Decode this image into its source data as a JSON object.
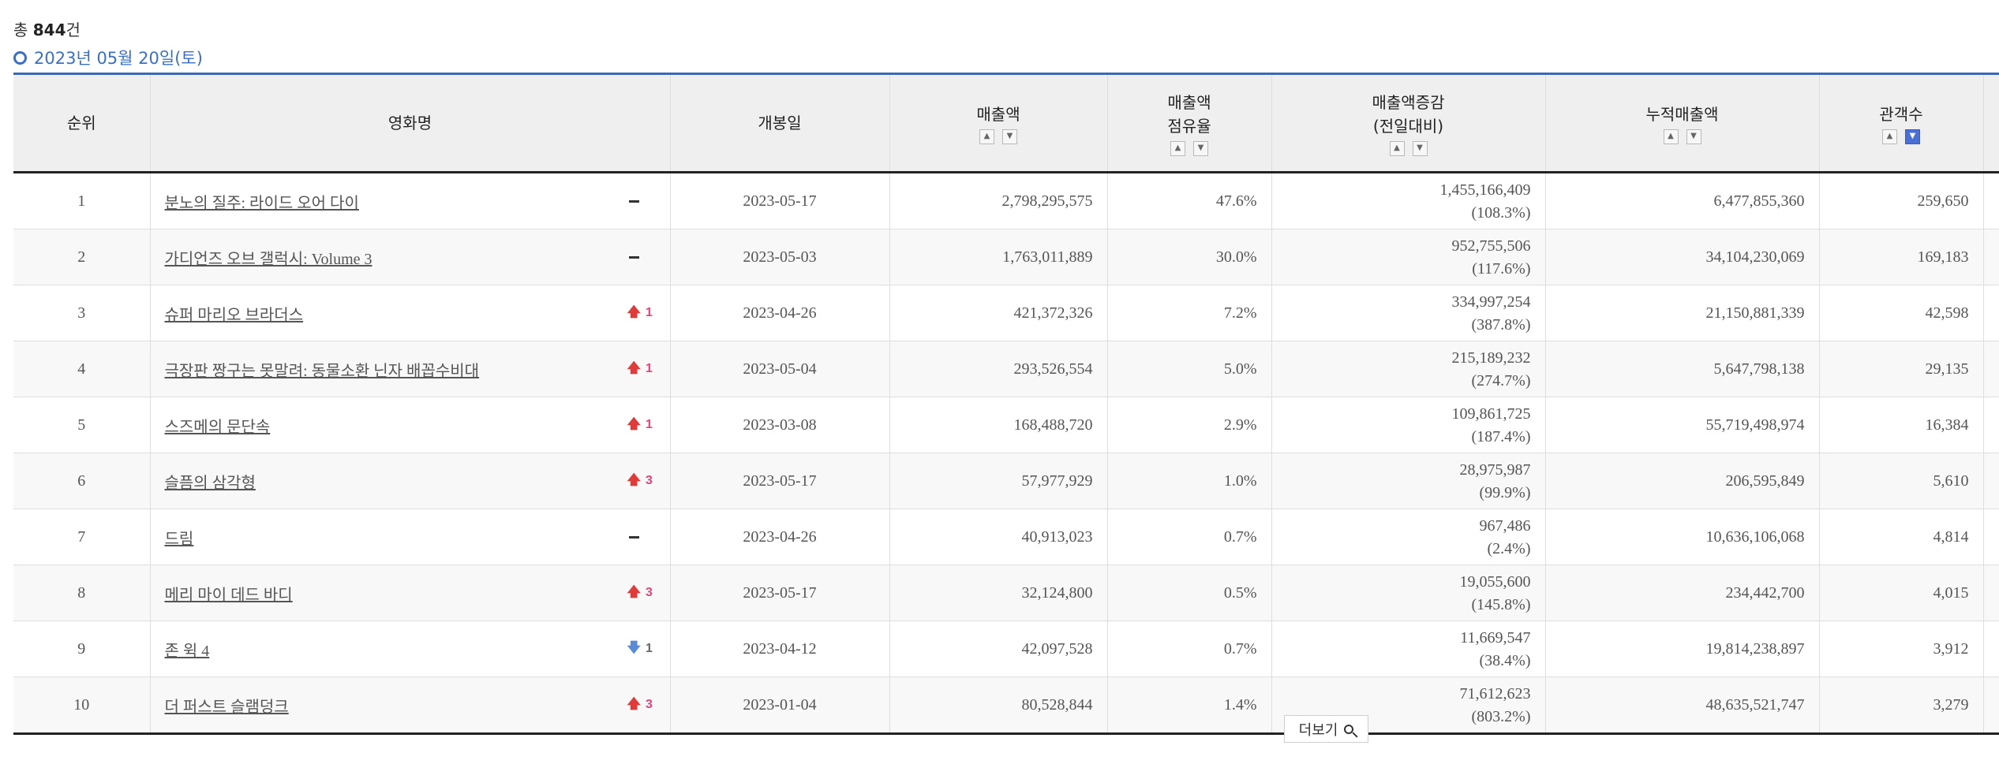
{
  "summary": {
    "prefix": "총 ",
    "count": "844",
    "suffix": "건"
  },
  "date_label": "2023년 05월 20일(토)",
  "columns": {
    "rank": "순위",
    "title": "영화명",
    "release": "개봉일",
    "sales": "매출액",
    "share_l1": "매출액",
    "share_l2": "점유율",
    "change_l1": "매출액증감",
    "change_l2": "(전일대비)",
    "cumulative": "누적매출액",
    "audience": "관객수"
  },
  "rows": [
    {
      "rank": "1",
      "title": "분노의 질주: 라이드 오어 다이",
      "rank_change": "none",
      "rank_delta": "",
      "release": "2023-05-17",
      "sales": "2,798,295,575",
      "share": "47.6%",
      "diff": "1,455,166,409",
      "diff_pct": "(108.3%)",
      "cumulative": "6,477,855,360",
      "audience": "259,650"
    },
    {
      "rank": "2",
      "title": "가디언즈 오브 갤럭시: Volume 3",
      "rank_change": "none",
      "rank_delta": "",
      "release": "2023-05-03",
      "sales": "1,763,011,889",
      "share": "30.0%",
      "diff": "952,755,506",
      "diff_pct": "(117.6%)",
      "cumulative": "34,104,230,069",
      "audience": "169,183"
    },
    {
      "rank": "3",
      "title": "슈퍼 마리오 브라더스",
      "rank_change": "up",
      "rank_delta": "1",
      "release": "2023-04-26",
      "sales": "421,372,326",
      "share": "7.2%",
      "diff": "334,997,254",
      "diff_pct": "(387.8%)",
      "cumulative": "21,150,881,339",
      "audience": "42,598"
    },
    {
      "rank": "4",
      "title": "극장판 짱구는 못말려: 동물소환 닌자 배꼽수비대",
      "rank_change": "up",
      "rank_delta": "1",
      "release": "2023-05-04",
      "sales": "293,526,554",
      "share": "5.0%",
      "diff": "215,189,232",
      "diff_pct": "(274.7%)",
      "cumulative": "5,647,798,138",
      "audience": "29,135"
    },
    {
      "rank": "5",
      "title": "스즈메의 문단속",
      "rank_change": "up",
      "rank_delta": "1",
      "release": "2023-03-08",
      "sales": "168,488,720",
      "share": "2.9%",
      "diff": "109,861,725",
      "diff_pct": "(187.4%)",
      "cumulative": "55,719,498,974",
      "audience": "16,384"
    },
    {
      "rank": "6",
      "title": "슬픔의 삼각형",
      "rank_change": "up",
      "rank_delta": "3",
      "release": "2023-05-17",
      "sales": "57,977,929",
      "share": "1.0%",
      "diff": "28,975,987",
      "diff_pct": "(99.9%)",
      "cumulative": "206,595,849",
      "audience": "5,610"
    },
    {
      "rank": "7",
      "title": "드림",
      "rank_change": "none",
      "rank_delta": "",
      "release": "2023-04-26",
      "sales": "40,913,023",
      "share": "0.7%",
      "diff": "967,486",
      "diff_pct": "(2.4%)",
      "cumulative": "10,636,106,068",
      "audience": "4,814"
    },
    {
      "rank": "8",
      "title": "메리 마이 데드 바디",
      "rank_change": "up",
      "rank_delta": "3",
      "release": "2023-05-17",
      "sales": "32,124,800",
      "share": "0.5%",
      "diff": "19,055,600",
      "diff_pct": "(145.8%)",
      "cumulative": "234,442,700",
      "audience": "4,015"
    },
    {
      "rank": "9",
      "title": "존 윅 4",
      "rank_change": "down",
      "rank_delta": "1",
      "release": "2023-04-12",
      "sales": "42,097,528",
      "share": "0.7%",
      "diff": "11,669,547",
      "diff_pct": "(38.4%)",
      "cumulative": "19,814,238,897",
      "audience": "3,912"
    },
    {
      "rank": "10",
      "title": "더 퍼스트 슬램덩크",
      "rank_change": "up",
      "rank_delta": "3",
      "release": "2023-01-04",
      "sales": "80,528,844",
      "share": "1.4%",
      "diff": "71,612,623",
      "diff_pct": "(803.2%)",
      "cumulative": "48,635,521,747",
      "audience": "3,279"
    }
  ],
  "more_button": "더보기",
  "icons": {
    "sort_asc": "chevron-up-icon",
    "sort_desc": "chevron-down-icon",
    "rank_up": "arrow-up-icon",
    "rank_down": "arrow-down-icon",
    "rank_same": "dash-icon",
    "search": "search-icon"
  },
  "colors": {
    "accent": "#3a6fc9",
    "active_sort": "#4a6fd6",
    "rank_up_text": "#e0457b",
    "rank_up_arrow": "#e03a3a",
    "rank_down_arrow": "#5b8bd6"
  }
}
